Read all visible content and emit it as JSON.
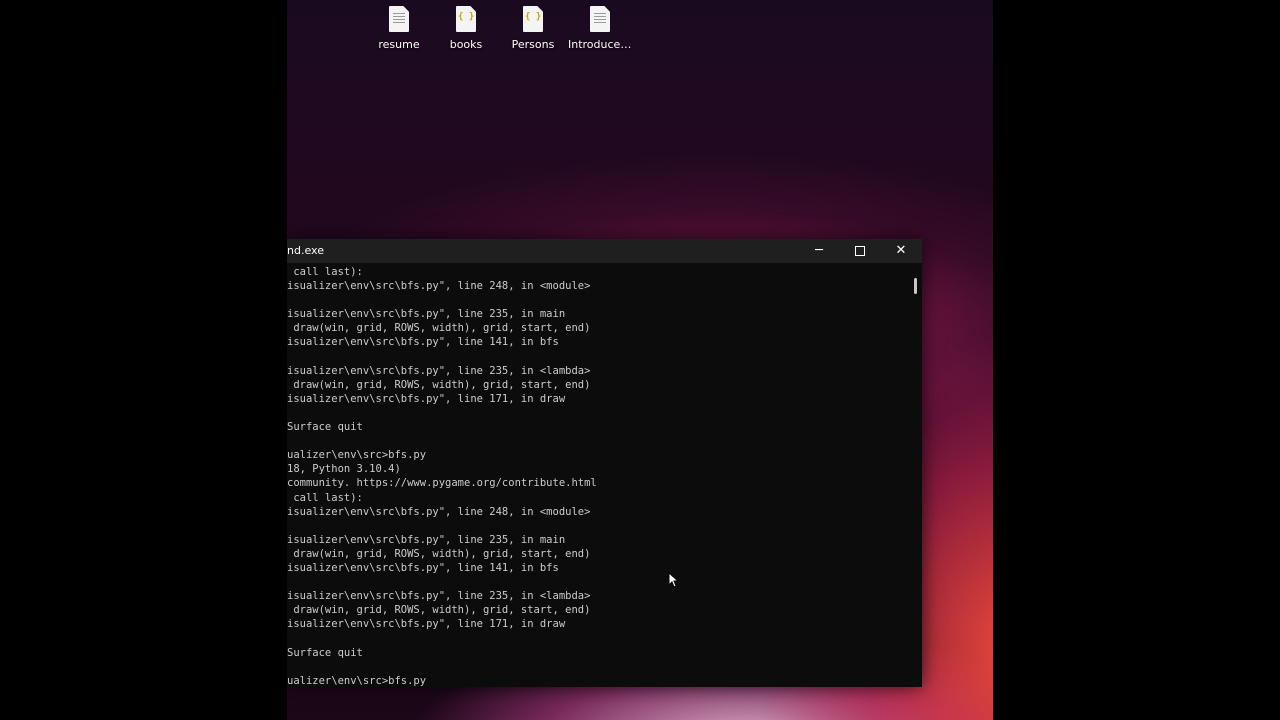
{
  "desktop": {
    "icons": [
      {
        "label": "resume",
        "type": "text"
      },
      {
        "label": "books",
        "type": "json"
      },
      {
        "label": "Persons",
        "type": "json"
      },
      {
        "label": "IntroduceY...",
        "type": "text"
      }
    ]
  },
  "terminal": {
    "title": "nd.exe",
    "buttons": {
      "minimize": "─",
      "close": "✕"
    },
    "lines": [
      " call last):",
      "isualizer\\env\\src\\bfs.py\", line 248, in <module>",
      "",
      "isualizer\\env\\src\\bfs.py\", line 235, in main",
      " draw(win, grid, ROWS, width), grid, start, end)",
      "isualizer\\env\\src\\bfs.py\", line 141, in bfs",
      "",
      "isualizer\\env\\src\\bfs.py\", line 235, in <lambda>",
      " draw(win, grid, ROWS, width), grid, start, end)",
      "isualizer\\env\\src\\bfs.py\", line 171, in draw",
      "",
      "Surface quit",
      "",
      "ualizer\\env\\src>bfs.py",
      "18, Python 3.10.4)",
      "community. https://www.pygame.org/contribute.html",
      " call last):",
      "isualizer\\env\\src\\bfs.py\", line 248, in <module>",
      "",
      "isualizer\\env\\src\\bfs.py\", line 235, in main",
      " draw(win, grid, ROWS, width), grid, start, end)",
      "isualizer\\env\\src\\bfs.py\", line 141, in bfs",
      "",
      "isualizer\\env\\src\\bfs.py\", line 235, in <lambda>",
      " draw(win, grid, ROWS, width), grid, start, end)",
      "isualizer\\env\\src\\bfs.py\", line 171, in draw",
      "",
      "Surface quit",
      "",
      "ualizer\\env\\src>bfs.py"
    ]
  }
}
